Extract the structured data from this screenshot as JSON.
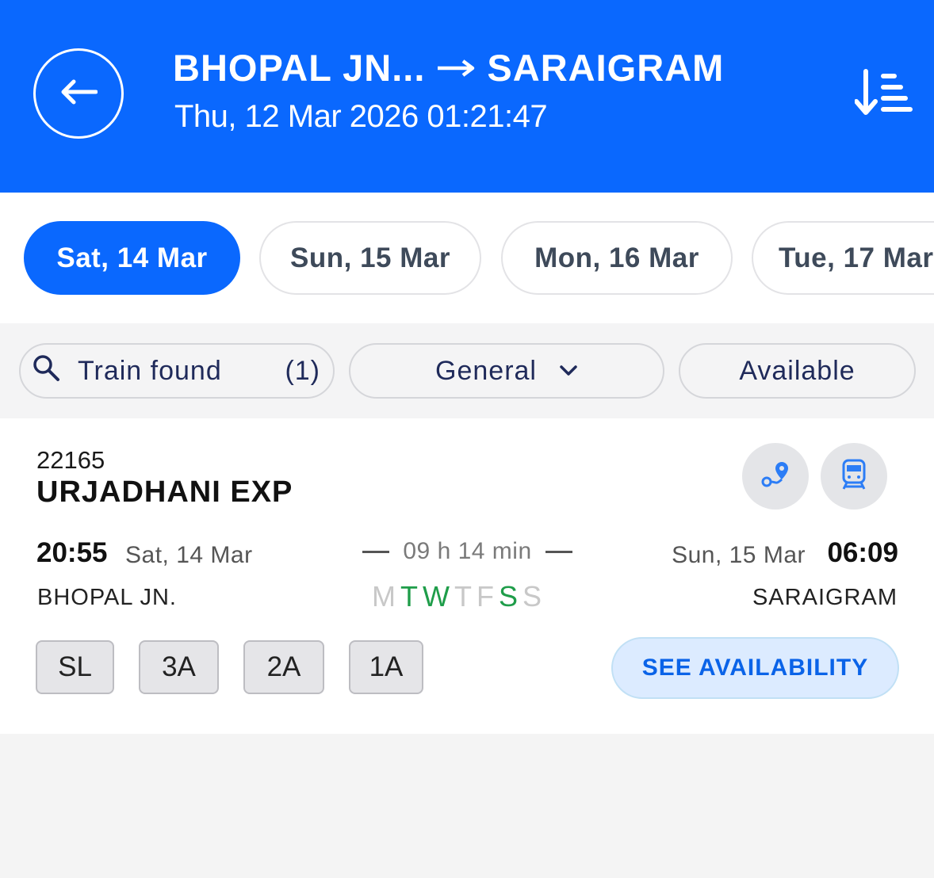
{
  "header": {
    "from": "BHOPAL JN...",
    "to": "SARAIGRAM",
    "datetime": "Thu, 12 Mar 2026 01:21:47",
    "back_icon": "arrow-left-icon",
    "sort_icon": "sort-descending-icon",
    "bg_color": "#0a68fe"
  },
  "dates": [
    {
      "label": "Sat, 14 Mar",
      "selected": true
    },
    {
      "label": "Sun, 15 Mar",
      "selected": false
    },
    {
      "label": "Mon, 16 Mar",
      "selected": false
    },
    {
      "label": "Tue, 17 Mar",
      "selected": false
    }
  ],
  "filters": {
    "search_label": "Train found",
    "search_count": "(1)",
    "quota": "General",
    "availability": "Available"
  },
  "train": {
    "number": "22165",
    "name": "URJADHANI EXP",
    "departure": {
      "time": "20:55",
      "date": "Sat, 14 Mar",
      "station": "BHOPAL JN."
    },
    "arrival": {
      "time": "06:09",
      "date": "Sun, 15 Mar",
      "station": "SARAIGRAM"
    },
    "duration": "09 h 14 min",
    "days": [
      {
        "d": "M",
        "runs": false
      },
      {
        "d": "T",
        "runs": true
      },
      {
        "d": "W",
        "runs": true
      },
      {
        "d": "T",
        "runs": false
      },
      {
        "d": "F",
        "runs": false
      },
      {
        "d": "S",
        "runs": true
      },
      {
        "d": "S",
        "runs": false
      }
    ],
    "classes": [
      "SL",
      "3A",
      "2A",
      "1A"
    ],
    "see_availability": "SEE AVAILABILITY",
    "route_icon": "route-map-icon",
    "train_icon": "train-icon"
  },
  "colors": {
    "accent": "#0a68fe",
    "runs_day": "#1f9d4a",
    "off_day": "#c8c8c8"
  }
}
